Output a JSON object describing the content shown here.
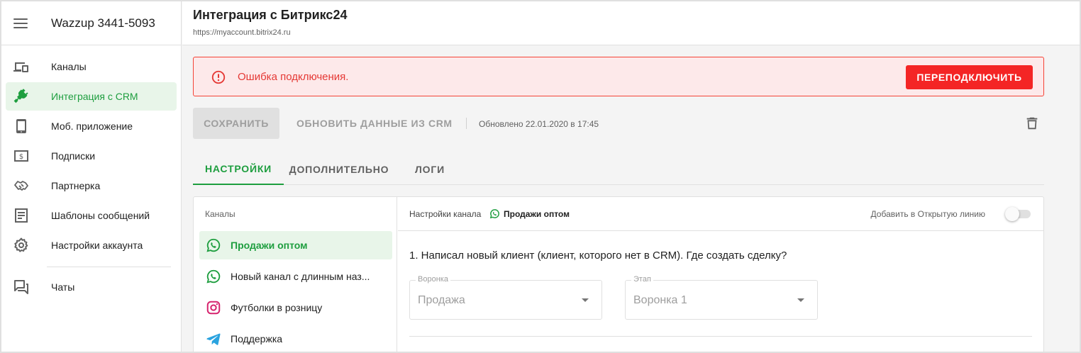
{
  "sidebar": {
    "account": "Wazzup 3441-5093",
    "items": [
      {
        "label": "Каналы",
        "icon": "devices-icon"
      },
      {
        "label": "Интеграция с CRM",
        "icon": "plug-icon",
        "active": true
      },
      {
        "label": "Моб. приложение",
        "icon": "phone-icon"
      },
      {
        "label": "Подписки",
        "icon": "dollar-note-icon"
      },
      {
        "label": "Партнерка",
        "icon": "handshake-icon"
      },
      {
        "label": "Шаблоны сообщений",
        "icon": "document-icon"
      },
      {
        "label": "Настройки аккаунта",
        "icon": "gear-icon"
      },
      {
        "label": "Чаты",
        "icon": "chat-icon"
      }
    ]
  },
  "header": {
    "title": "Интеграция с Битрикс24",
    "url": "https://myaccount.bitrix24.ru"
  },
  "error": {
    "message": "Ошибка подключения.",
    "action_label": "ПЕРЕПОДКЛЮЧИТЬ"
  },
  "toolbar": {
    "save_label": "СОХРАНИТЬ",
    "refresh_label": "ОБНОВИТЬ ДАННЫЕ ИЗ CRM",
    "updated_text": "Обновлено 22.01.2020 в 17:45"
  },
  "tabs": [
    {
      "label": "НАСТРОЙКИ",
      "active": true
    },
    {
      "label": "ДОПОЛНИТЕЛЬНО"
    },
    {
      "label": "ЛОГИ"
    }
  ],
  "channels": {
    "title": "Каналы",
    "items": [
      {
        "label": "Продажи оптом",
        "icon": "whatsapp-icon",
        "active": true
      },
      {
        "label": "Новый канал с длинным наз...",
        "icon": "whatsapp-icon"
      },
      {
        "label": "Футболки в розницу",
        "icon": "instagram-icon"
      },
      {
        "label": "Поддержка",
        "icon": "telegram-icon"
      }
    ]
  },
  "channel_settings": {
    "label": "Настройки канала",
    "channel_name": "Продажи оптом",
    "open_line_label": "Добавить в Открытую линию",
    "open_line_enabled": false,
    "question": "1. Написал новый клиент (клиент, которого нет в CRM). Где создать сделку?",
    "funnel": {
      "label": "Воронка",
      "value": "Продажа"
    },
    "stage": {
      "label": "Этап",
      "value": "Воронка 1"
    }
  },
  "colors": {
    "accent": "#1e9e3f",
    "active_bg": "#e8f5e9",
    "error": "#f42525",
    "error_bg": "#fde9ea"
  }
}
